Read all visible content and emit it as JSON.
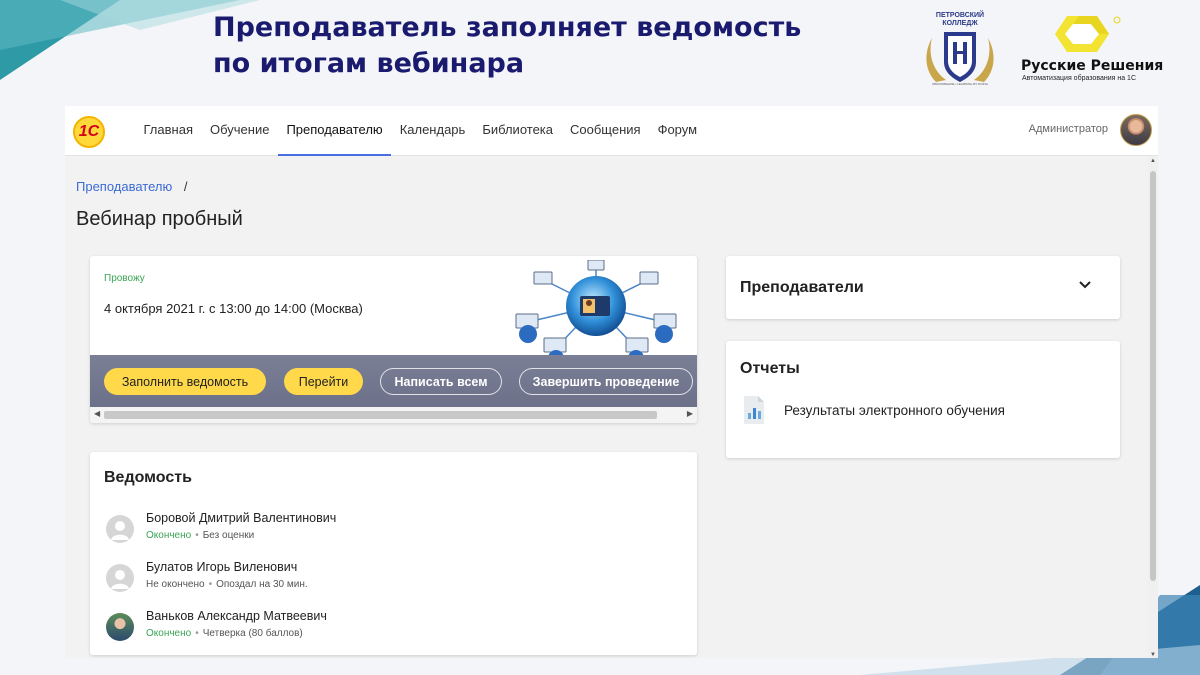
{
  "slide": {
    "title_line1": "Преподаватель заполняет ведомость",
    "title_line2": "по итогам вебинара",
    "college_name": "ПЕТРОВСКИЙ КОЛЛЕДЖ",
    "college_motto": "ОБРАЗОВАНИЕ • LEARNING BY DOING",
    "partner_name": "Русские Решения",
    "partner_tagline": "Автоматизация образования на 1С"
  },
  "app": {
    "logo_text": "1С",
    "nav": [
      {
        "label": "Главная",
        "active": false
      },
      {
        "label": "Обучение",
        "active": false
      },
      {
        "label": "Преподавателю",
        "active": true
      },
      {
        "label": "Календарь",
        "active": false
      },
      {
        "label": "Библиотека",
        "active": false
      },
      {
        "label": "Сообщения",
        "active": false
      },
      {
        "label": "Форум",
        "active": false
      }
    ],
    "user_name": "Администратор"
  },
  "page": {
    "breadcrumb": {
      "link": "Преподавателю",
      "separator": "/"
    },
    "title": "Вебинар пробный"
  },
  "event": {
    "status": "Провожу",
    "datetime": "4 октября 2021 г. с 13:00 до 14:00 (Москва)",
    "actions": {
      "fill_sheet": "Заполнить ведомость",
      "go": "Перейти",
      "write_all": "Написать всем",
      "finish": "Завершить проведение"
    }
  },
  "teachers": {
    "title": "Преподаватели"
  },
  "reports": {
    "title": "Отчеты",
    "items": [
      {
        "label": "Результаты электронного обучения"
      }
    ]
  },
  "grades": {
    "title": "Ведомость",
    "students": [
      {
        "name": "Боровой Дмитрий Валентинович",
        "status": "Окончено",
        "separator": "•",
        "result": "Без оценки",
        "completed": true
      },
      {
        "name": "Булатов Игорь Виленович",
        "status": "Не окончено",
        "separator": "•",
        "result": "Опоздал на 30 мин.",
        "completed": false
      },
      {
        "name": "Ваньков Александр Матвеевич",
        "status": "Окончено",
        "separator": "•",
        "result": "Четверка (80 баллов)",
        "completed": true
      }
    ]
  },
  "colors": {
    "title_navy": "#1a1a6e",
    "accent_blue": "#4a6ee0",
    "button_yellow": "#ffd94a",
    "status_green": "#3aa655",
    "action_bar": "#72778f"
  }
}
